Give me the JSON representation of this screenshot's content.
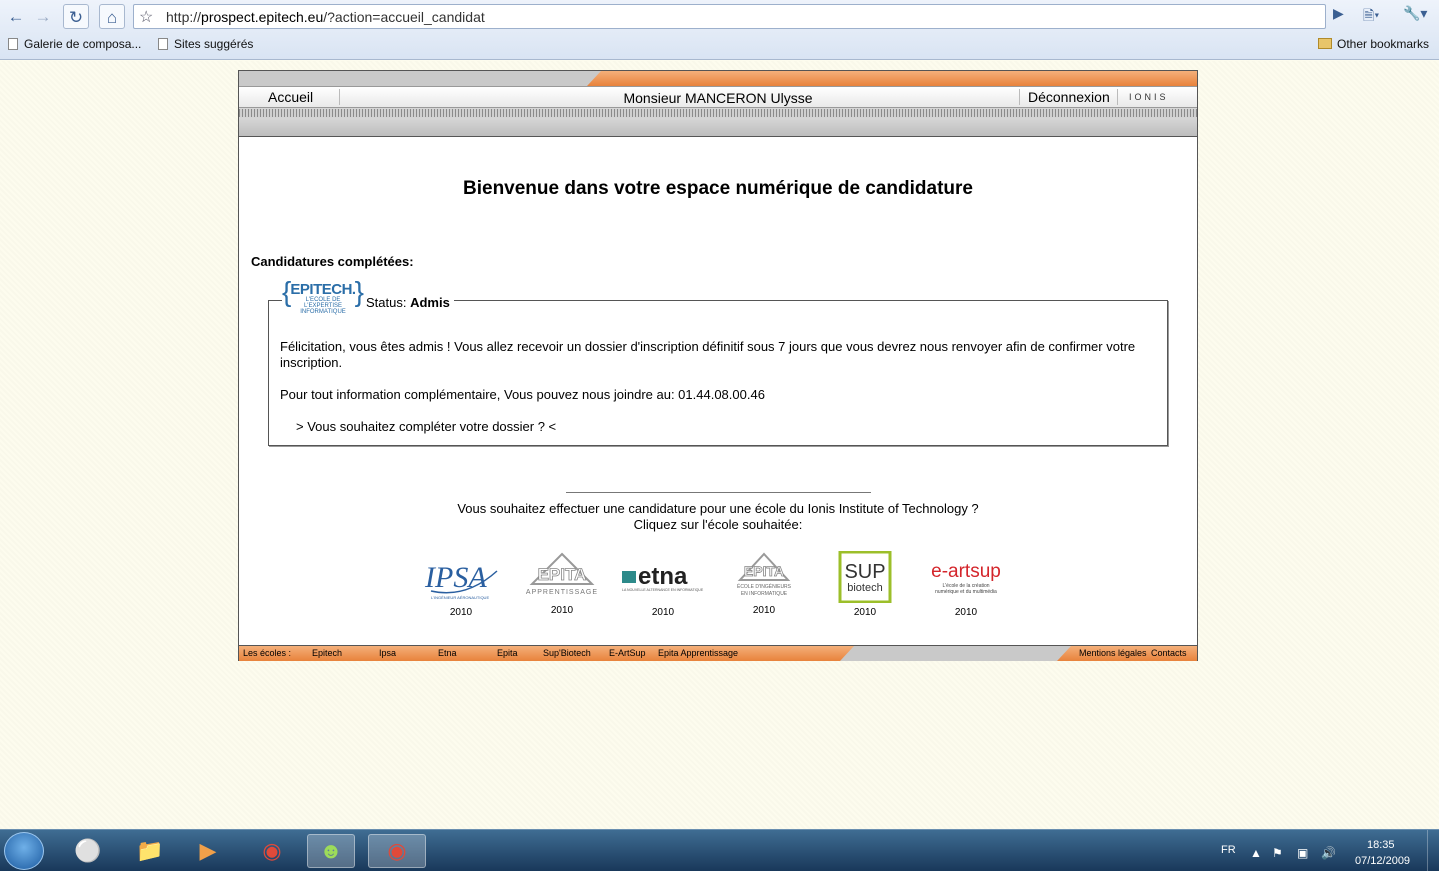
{
  "browser": {
    "url_prefix": "http://",
    "url_host": "prospect.epitech.eu",
    "url_path": "/?action=accueil_candidat",
    "bookmarks": [
      "Galerie de composa...",
      "Sites suggérés"
    ],
    "other_bookmarks": "Other bookmarks"
  },
  "nav": {
    "home": "Accueil",
    "user": "Monsieur MANCERON Ulysse",
    "logout": "Déconnexion",
    "brand": "IONIS"
  },
  "main": {
    "title": "Bienvenue dans votre espace numérique de candidature",
    "completed_label": "Candidatures complétées:",
    "application": {
      "school_logo_name": "EPITECH.",
      "school_logo_sub1": "L'ECOLE DE",
      "school_logo_sub2": "L'EXPERTISE",
      "school_logo_sub3": "INFORMATIQUE",
      "status_label": "Status:",
      "status_value": "Admis",
      "message": "Félicitation, vous êtes admis ! Vous allez recevoir un dossier d'inscription définitif sous 7 jours que vous devrez nous renvoyer afin de confirmer votre inscription.",
      "info": "Pour tout information complémentaire, Vous pouvez nous joindre au: 01.44.08.00.46",
      "complete_link": "> Vous souhaitez compléter votre dossier ? <"
    },
    "other_line1": "Vous souhaitez effectuer une candidature pour une école du Ionis Institute of Technology ?",
    "other_line2": "Cliquez sur l'école souhaitée:",
    "schools": [
      {
        "logo": "IPSA",
        "year": "2010"
      },
      {
        "logo": "EPITA",
        "sub": "APPRENTISSAGE",
        "year": "2010"
      },
      {
        "logo": "etna",
        "year": "2010"
      },
      {
        "logo": "EPITA",
        "sub": "ÉCOLE D'INGÉNIEURS EN INFORMATIQUE",
        "year": "2010"
      },
      {
        "logo": "SUP",
        "sub": "biotech",
        "year": "2010"
      },
      {
        "logo": "e-artsup",
        "sub": "L'école de la création numérique et du multimédia",
        "year": "2010"
      }
    ]
  },
  "footer": {
    "label": "Les écoles :",
    "links": [
      "Epitech",
      "Ipsa",
      "Etna",
      "Epita",
      "Sup'Biotech",
      "E-ArtSup",
      "Epita Apprentissage"
    ],
    "legal": "Mentions légales",
    "contacts": "Contacts"
  },
  "taskbar": {
    "lang": "FR",
    "time": "18:35",
    "date": "07/12/2009"
  },
  "colors": {
    "accent_orange": "#e8823c",
    "page_bg": "#fdfcee",
    "epitech_blue": "#2b6ea8",
    "supbiotech_green": "#9cbf2a",
    "eartsup_red": "#d4252b"
  }
}
